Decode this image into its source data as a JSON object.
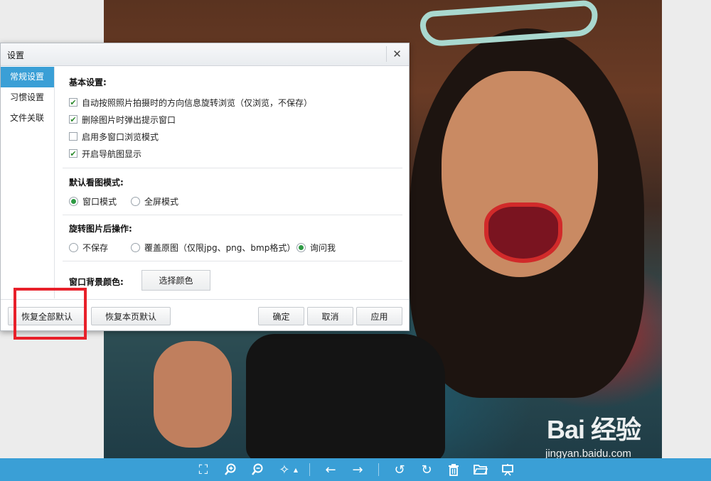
{
  "dialog": {
    "title": "设置",
    "close_glyph": "✕",
    "sidebar": [
      {
        "label": "常规设置",
        "active": true
      },
      {
        "label": "习惯设置",
        "active": false
      },
      {
        "label": "文件关联",
        "active": false
      }
    ],
    "basic": {
      "title": "基本设置:",
      "options": [
        {
          "label": "自动按照照片拍摄时的方向信息旋转浏览（仅浏览，不保存）",
          "checked": true
        },
        {
          "label": "删除图片时弹出提示窗口",
          "checked": true
        },
        {
          "label": "启用多窗口浏览模式",
          "checked": false
        },
        {
          "label": "开启导航图显示",
          "checked": true
        }
      ]
    },
    "view_mode": {
      "title": "默认看图模式:",
      "options": [
        {
          "label": "窗口模式",
          "selected": true
        },
        {
          "label": "全屏模式",
          "selected": false
        }
      ]
    },
    "rotate": {
      "title": "旋转图片后操作:",
      "options": [
        {
          "label": "不保存",
          "selected": false
        },
        {
          "label": "覆盖原图（仅限jpg、png、bmp格式）",
          "selected": false
        },
        {
          "label": "询问我",
          "selected": true
        }
      ]
    },
    "bg_color": {
      "title": "窗口背景颜色:",
      "button": "选择颜色"
    },
    "footer": {
      "restore_all": "恢复全部默认",
      "restore_page": "恢复本页默认",
      "ok": "确定",
      "cancel": "取消",
      "apply": "应用"
    }
  },
  "watermark": {
    "brand": "Bai 经验",
    "url": "jingyan.baidu.com"
  },
  "toolbar": {
    "icons": [
      "fit-icon",
      "zoom-in-icon",
      "zoom-out-icon",
      "magic-wand-icon",
      "prev-icon",
      "next-icon",
      "rotate-left-icon",
      "rotate-right-icon",
      "delete-icon",
      "open-folder-icon",
      "slideshow-icon"
    ]
  },
  "colors": {
    "accent": "#3a9fd6",
    "check": "#2e8b2e",
    "highlight": "#e8202a"
  }
}
